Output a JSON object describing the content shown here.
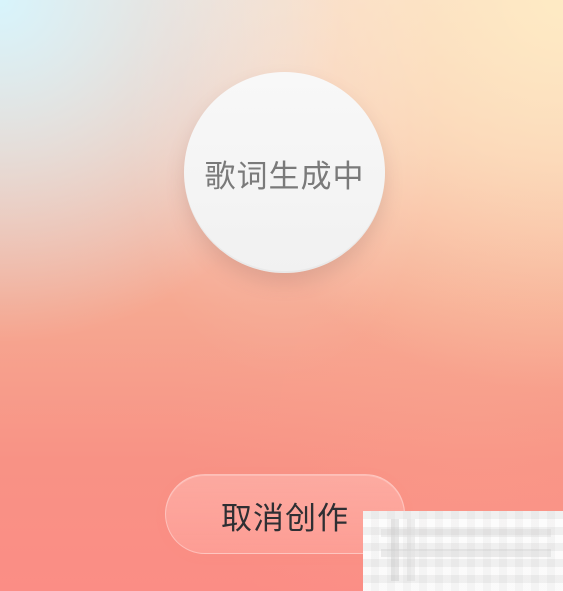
{
  "status": {
    "text": "歌词生成中"
  },
  "actions": {
    "cancel_label": "取消创作"
  },
  "watermark": {
    "name": "pixelated-watermark"
  },
  "colors": {
    "background_top_left": "#d6f6ff",
    "background_top_right": "#ffecc4",
    "background_bottom": "#fb8d85",
    "circle_fill": "#f4f4f4",
    "circle_text": "#7a7a7a",
    "button_fill": "#ffb8b1",
    "button_text": "#2e2f33"
  }
}
